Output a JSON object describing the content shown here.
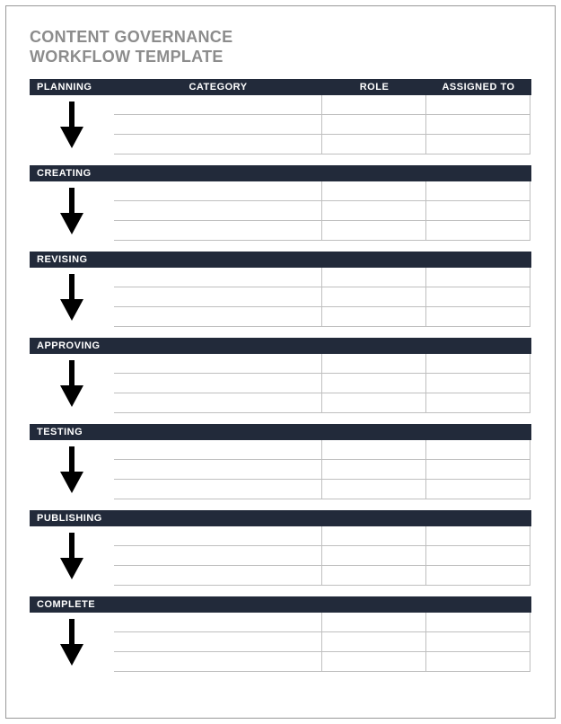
{
  "title_line1": "CONTENT GOVERNANCE",
  "title_line2": "WORKFLOW TEMPLATE",
  "columns": {
    "stage": "",
    "category": "CATEGORY",
    "role": "ROLE",
    "assigned_to": "ASSIGNED TO"
  },
  "sections": [
    {
      "stage": "PLANNING",
      "rows": [
        {
          "category": "",
          "role": "",
          "assigned_to": ""
        },
        {
          "category": "",
          "role": "",
          "assigned_to": ""
        },
        {
          "category": "",
          "role": "",
          "assigned_to": ""
        }
      ]
    },
    {
      "stage": "CREATING",
      "rows": [
        {
          "category": "",
          "role": "",
          "assigned_to": ""
        },
        {
          "category": "",
          "role": "",
          "assigned_to": ""
        },
        {
          "category": "",
          "role": "",
          "assigned_to": ""
        }
      ]
    },
    {
      "stage": "REVISING",
      "rows": [
        {
          "category": "",
          "role": "",
          "assigned_to": ""
        },
        {
          "category": "",
          "role": "",
          "assigned_to": ""
        },
        {
          "category": "",
          "role": "",
          "assigned_to": ""
        }
      ]
    },
    {
      "stage": "APPROVING",
      "rows": [
        {
          "category": "",
          "role": "",
          "assigned_to": ""
        },
        {
          "category": "",
          "role": "",
          "assigned_to": ""
        },
        {
          "category": "",
          "role": "",
          "assigned_to": ""
        }
      ]
    },
    {
      "stage": "TESTING",
      "rows": [
        {
          "category": "",
          "role": "",
          "assigned_to": ""
        },
        {
          "category": "",
          "role": "",
          "assigned_to": ""
        },
        {
          "category": "",
          "role": "",
          "assigned_to": ""
        }
      ]
    },
    {
      "stage": "PUBLISHING",
      "rows": [
        {
          "category": "",
          "role": "",
          "assigned_to": ""
        },
        {
          "category": "",
          "role": "",
          "assigned_to": ""
        },
        {
          "category": "",
          "role": "",
          "assigned_to": ""
        }
      ]
    },
    {
      "stage": "COMPLETE",
      "rows": [
        {
          "category": "",
          "role": "",
          "assigned_to": ""
        },
        {
          "category": "",
          "role": "",
          "assigned_to": ""
        },
        {
          "category": "",
          "role": "",
          "assigned_to": ""
        }
      ]
    }
  ]
}
